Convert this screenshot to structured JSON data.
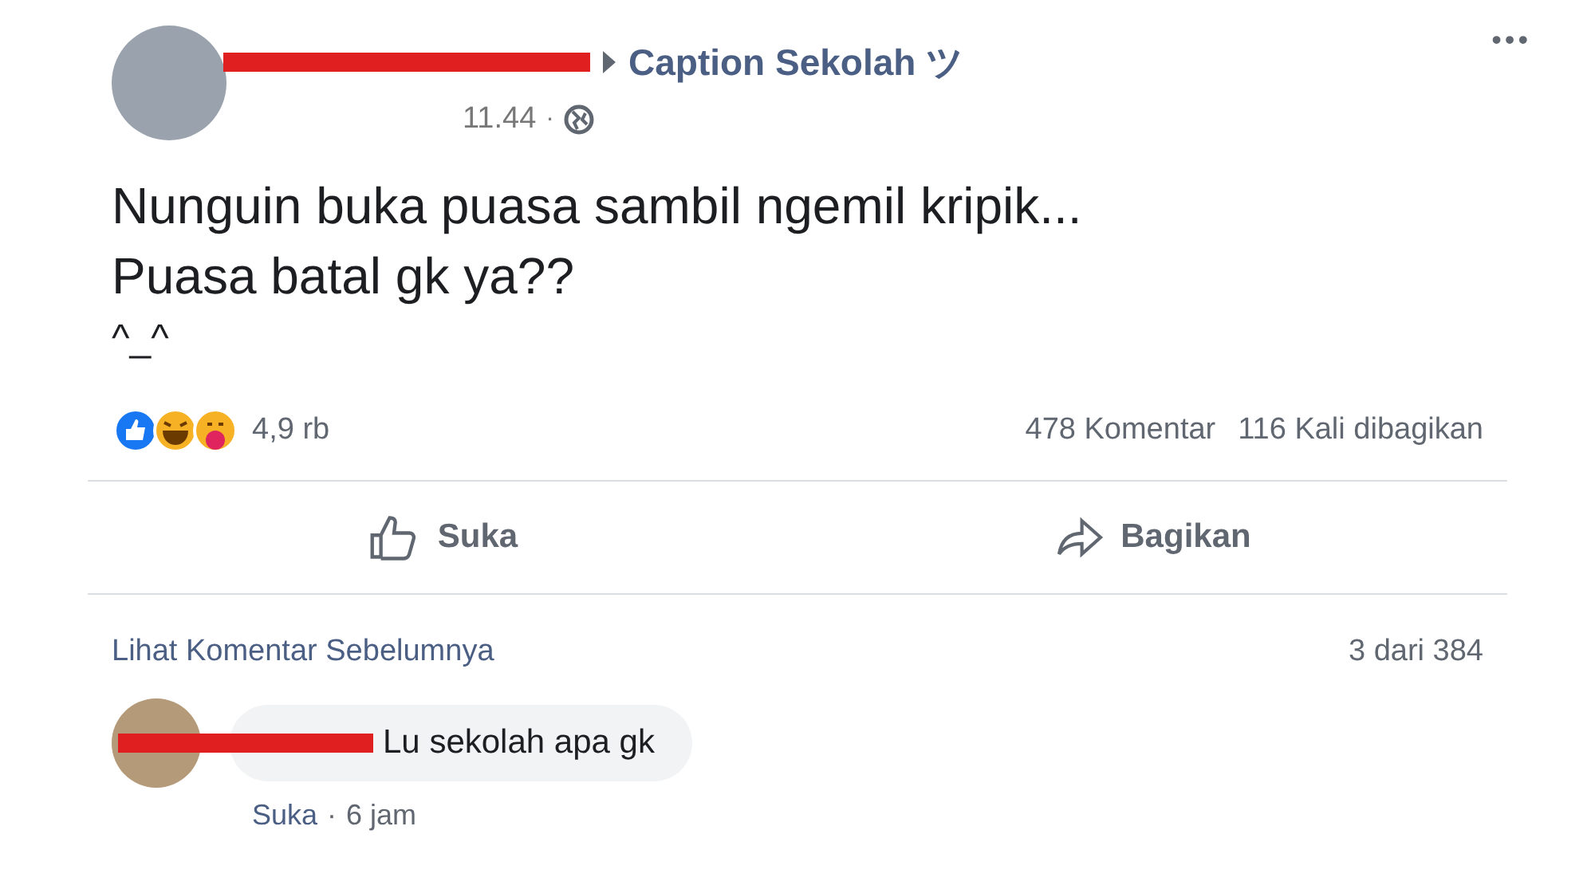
{
  "post": {
    "group": "Caption Sekolah ツ",
    "time": "11.44",
    "separator": "·",
    "text_lines": [
      "Nunguin buka puasa sambil ngemil kripik...",
      "Puasa batal gk ya??",
      "^_^"
    ],
    "more": "•••",
    "reactions_count": "4,9 rb",
    "comments_count": "478 Komentar",
    "shares_count": "116 Kali dibagikan",
    "actions": [
      {
        "kind": "like",
        "label": "Suka"
      },
      {
        "kind": "share",
        "label": "Bagikan"
      }
    ]
  },
  "comments_section": {
    "previous_link": "Lihat Komentar Sebelumnya",
    "counter": "3 dari 384",
    "comments": [
      {
        "text": "Lu sekolah apa gk",
        "like": "Suka",
        "separator": "·",
        "time": "6 jam"
      }
    ]
  }
}
